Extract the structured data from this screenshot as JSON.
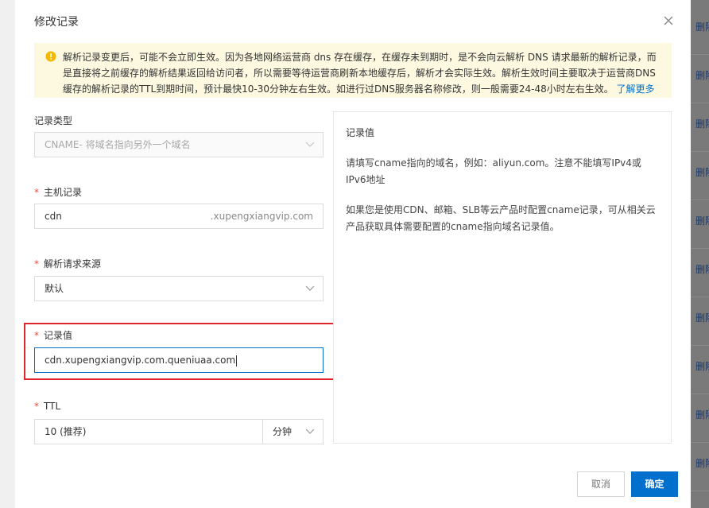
{
  "background": {
    "row_action": "删除",
    "row_action_count": 10
  },
  "dialog": {
    "title": "修改记录",
    "notice": {
      "text": "解析记录变更后，可能不会立即生效。因为各地网络运营商 dns 存在缓存，在缓存未到期时，是不会向云解析 DNS 请求最新的解析记录，而是直接将之前缓存的解析结果返回给访问者，所以需要等待运营商刷新本地缓存后，解析才会实际生效。解析生效时间主要取决于运营商DNS缓存的解析记录的TTL到期时间，预计最快10-30分钟左右生效。如进行过DNS服务器名称修改，则一般需要24-48小时左右生效。",
      "link": "了解更多"
    },
    "form": {
      "record_type": {
        "label": "记录类型",
        "value": "CNAME- 将域名指向另外一个域名"
      },
      "host_record": {
        "label": "主机记录",
        "value": "cdn",
        "suffix": ".xupengxiangvip.com"
      },
      "request_source": {
        "label": "解析请求来源",
        "value": "默认"
      },
      "record_value": {
        "label": "记录值",
        "value": "cdn.xupengxiangvip.com.queniuaa.com"
      },
      "ttl": {
        "label": "TTL",
        "value": "10 (推荐)",
        "unit": "分钟"
      },
      "required_mark": "*"
    },
    "help": {
      "title": "记录值",
      "para1": "请填写cname指向的域名，例如：aliyun.com。注意不能填写IPv4或IPv6地址",
      "para2": "如果您是使用CDN、邮箱、SLB等云产品时配置cname记录，可从相关云产品获取具体需要配置的cname指向域名记录值。"
    },
    "buttons": {
      "cancel": "取消",
      "ok": "确定"
    }
  },
  "colors": {
    "primary": "#0070cc",
    "highlight": "#e0262f",
    "required": "#e84b3c",
    "notice_bg": "#fdf9e1",
    "warn": "#f5b800"
  }
}
